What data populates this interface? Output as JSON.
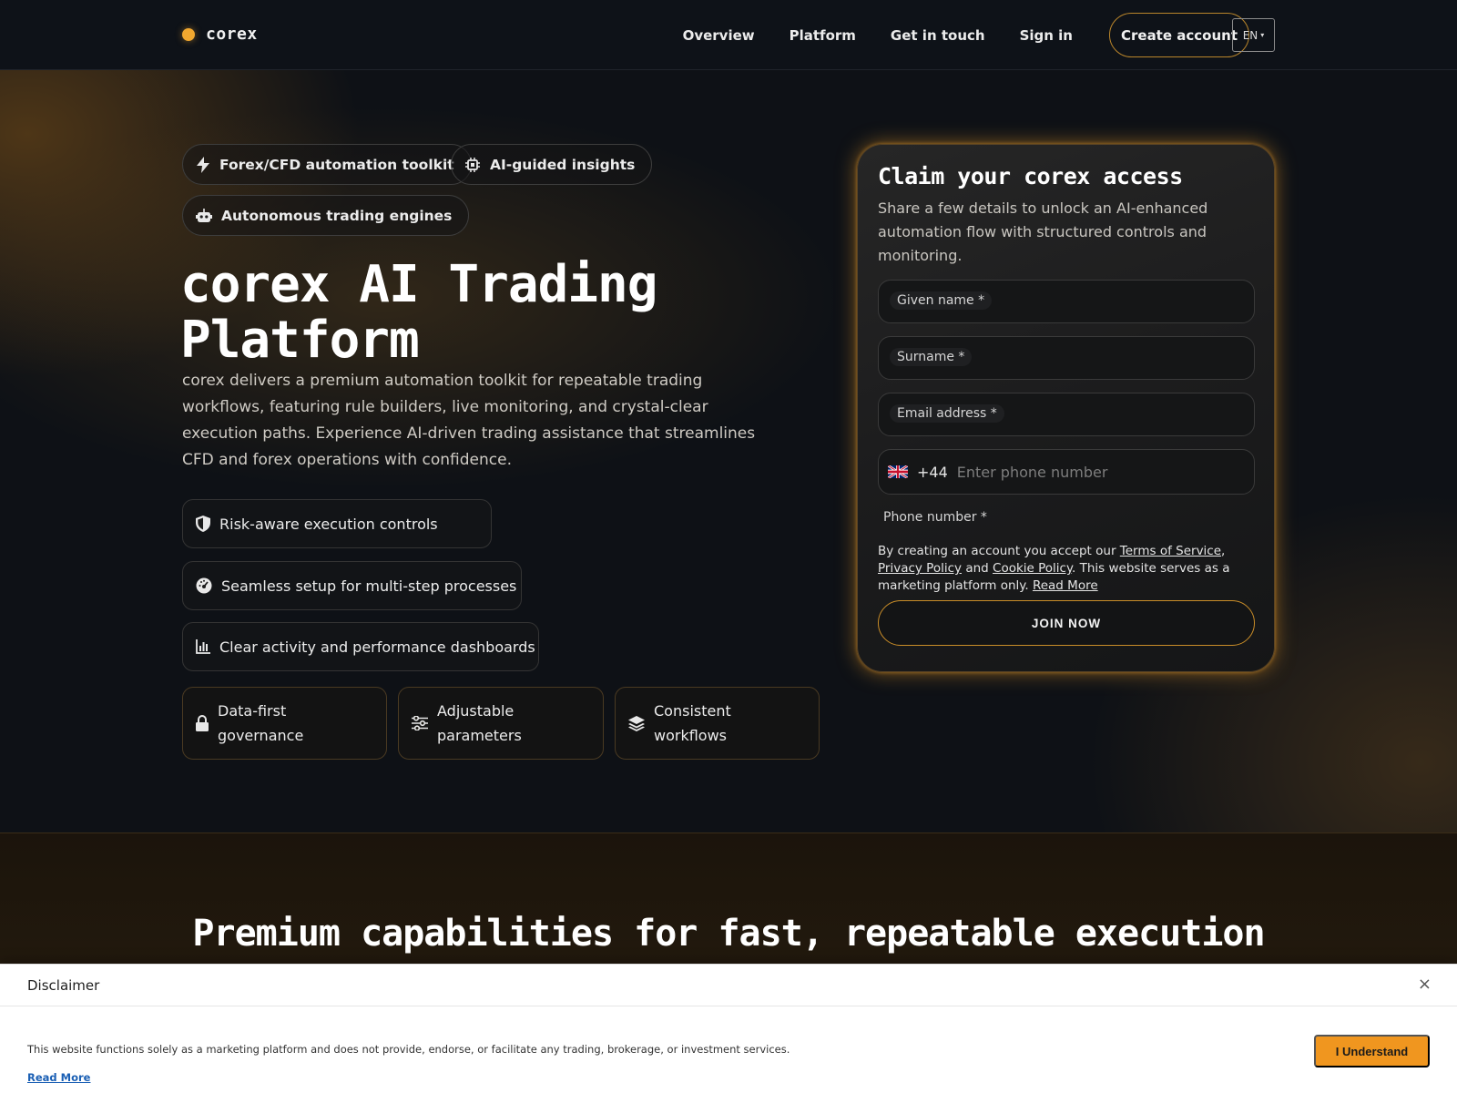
{
  "nav": {
    "brand": "corex",
    "links": [
      "Overview",
      "Platform",
      "Get in touch",
      "Sign in"
    ],
    "cta": "Create account",
    "language": "EN"
  },
  "hero": {
    "pills": [
      "Forex/CFD automation toolkit",
      "AI-guided insights",
      "Autonomous trading engines"
    ],
    "title": "corex AI Trading Platform",
    "description": "corex delivers a premium automation toolkit for repeatable trading workflows, featuring rule builders, live monitoring, and crystal-clear execution paths. Experience AI-driven trading assistance that streamlines CFD and forex operations with confidence.",
    "features": [
      "Risk-aware execution controls",
      "Seamless setup for multi-step processes",
      "Clear activity and performance dashboards"
    ],
    "cards": [
      "Data-first governance",
      "Adjustable parameters",
      "Consistent workflows"
    ]
  },
  "form": {
    "title": "Claim your corex access",
    "subtitle": "Share a few details to unlock an AI-enhanced automation flow with structured controls and monitoring.",
    "given_name_label": "Given name *",
    "surname_label": "Surname *",
    "email_label": "Email address *",
    "phone_code": "+44",
    "phone_placeholder": "Enter phone number",
    "phone_label": "Phone number *",
    "legal": {
      "prefix": "By creating an account you accept our",
      "terms": "Terms of Service",
      "comma": ",",
      "privacy": "Privacy Policy",
      "and": "and",
      "cookie": "Cookie Policy",
      "middle": ". This website serves as a marketing platform only.",
      "read_more": "Read More"
    },
    "submit": "JOIN NOW"
  },
  "section2": {
    "title": "Premium capabilities for fast, repeatable execution"
  },
  "disclaimer": {
    "title": "Disclaimer",
    "close": "×",
    "text": "This website functions solely as a marketing platform and does not provide, endorse, or facilitate any trading, brokerage, or investment services.",
    "read_more": "Read More",
    "button": "I Understand"
  },
  "colors": {
    "accent": "#f2a82f",
    "button": "#f0961f",
    "background": "#0e1116"
  },
  "icons": {
    "pills": [
      "bolt-icon",
      "chip-icon",
      "robot-icon"
    ],
    "features": [
      "shield-icon",
      "gauge-icon",
      "bar-chart-icon"
    ],
    "cards": [
      "lock-icon",
      "sliders-icon",
      "layers-icon"
    ]
  }
}
